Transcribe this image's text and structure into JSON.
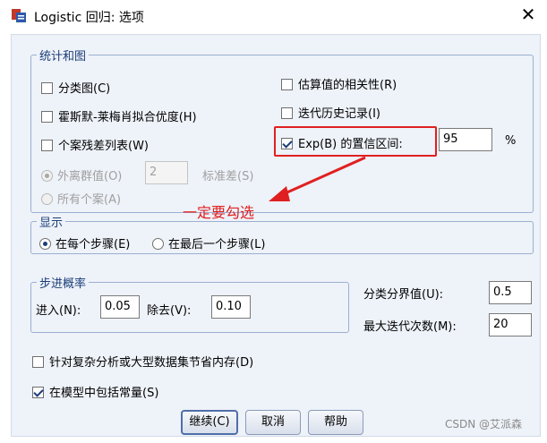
{
  "window": {
    "title": "Logistic 回归: 选项",
    "close_symbol": "✕"
  },
  "stats_plots": {
    "legend": "统计和图",
    "classification_plots": "分类图(C)",
    "hosmer_lemeshow": "霍斯默-莱梅肖拟合优度(H)",
    "casewise_listing": "个案残差列表(W)",
    "outliers_label": "外离群值(O)",
    "outliers_value": "2",
    "std_dev_label": "标准差(S)",
    "all_cases": "所有个案(A)",
    "correlations": "估算值的相关性(R)",
    "iteration_history": "迭代历史记录(I)",
    "ci_exp_label": "Exp(B) 的置信区间:",
    "ci_value": "95",
    "ci_unit": "%"
  },
  "display": {
    "legend": "显示",
    "each_step": "在每个步骤(E)",
    "last_step": "在最后一个步骤(L)"
  },
  "stepwise": {
    "legend": "步进概率",
    "entry_label": "进入(N):",
    "entry_value": "0.05",
    "removal_label": "除去(V):",
    "removal_value": "0.10"
  },
  "classification_cutoff": {
    "label": "分类分界值(U):",
    "value": "0.5"
  },
  "max_iterations": {
    "label": "最大迭代次数(M):",
    "value": "20"
  },
  "conserve_memory": "针对复杂分析或大型数据集节省内存(D)",
  "include_constant": "在模型中包括常量(S)",
  "buttons": {
    "continue": "继续(C)",
    "cancel": "取消",
    "help": "帮助"
  },
  "annotation": {
    "text": "一定要勾选",
    "color": "#e02020"
  },
  "watermark": "CSDN @艾派森",
  "colors": {
    "accent": "#1a3d78",
    "annotation": "#e02020",
    "panel": "#eef2f9"
  }
}
